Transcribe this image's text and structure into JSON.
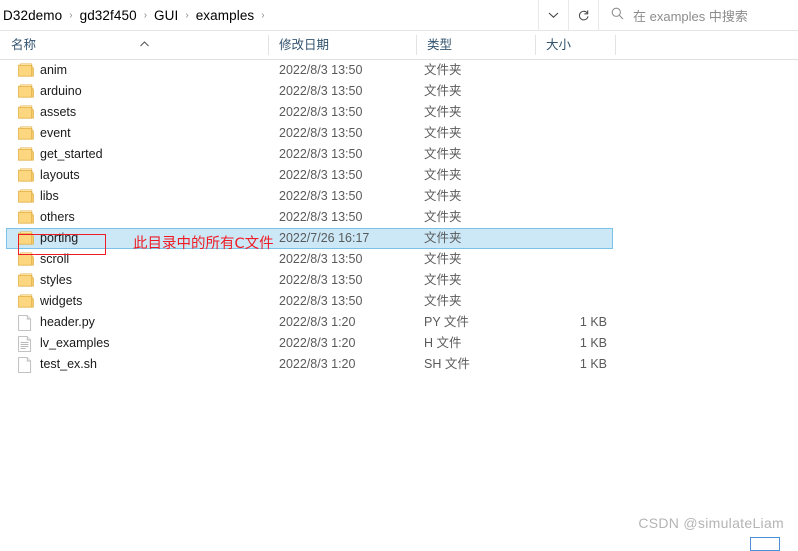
{
  "address_bar": {
    "breadcrumb": [
      {
        "label": "D32demo"
      },
      {
        "label": "gd32f450"
      },
      {
        "label": "GUI"
      },
      {
        "label": "examples"
      }
    ],
    "separator": "›",
    "dropdown_icon": "chevron-down-icon",
    "refresh_icon": "refresh-icon",
    "search": {
      "icon": "search-icon",
      "placeholder": "在 examples 中搜索",
      "value": ""
    }
  },
  "columns": {
    "name": "名称",
    "date_modified": "修改日期",
    "type": "类型",
    "size": "大小",
    "sort_column": "名称",
    "sort_direction": "ascending"
  },
  "files": [
    {
      "name": "anim",
      "date": "2022/8/3 13:50",
      "type": "文件夹",
      "size": "",
      "icon": "folder-icon",
      "selected": false
    },
    {
      "name": "arduino",
      "date": "2022/8/3 13:50",
      "type": "文件夹",
      "size": "",
      "icon": "folder-icon",
      "selected": false
    },
    {
      "name": "assets",
      "date": "2022/8/3 13:50",
      "type": "文件夹",
      "size": "",
      "icon": "folder-icon",
      "selected": false
    },
    {
      "name": "event",
      "date": "2022/8/3 13:50",
      "type": "文件夹",
      "size": "",
      "icon": "folder-icon",
      "selected": false
    },
    {
      "name": "get_started",
      "date": "2022/8/3 13:50",
      "type": "文件夹",
      "size": "",
      "icon": "folder-icon",
      "selected": false
    },
    {
      "name": "layouts",
      "date": "2022/8/3 13:50",
      "type": "文件夹",
      "size": "",
      "icon": "folder-icon",
      "selected": false
    },
    {
      "name": "libs",
      "date": "2022/8/3 13:50",
      "type": "文件夹",
      "size": "",
      "icon": "folder-icon",
      "selected": false
    },
    {
      "name": "others",
      "date": "2022/8/3 13:50",
      "type": "文件夹",
      "size": "",
      "icon": "folder-icon",
      "selected": false
    },
    {
      "name": "porting",
      "date": "2022/7/26 16:17",
      "type": "文件夹",
      "size": "",
      "icon": "folder-icon",
      "selected": true
    },
    {
      "name": "scroll",
      "date": "2022/8/3 13:50",
      "type": "文件夹",
      "size": "",
      "icon": "folder-icon",
      "selected": false
    },
    {
      "name": "styles",
      "date": "2022/8/3 13:50",
      "type": "文件夹",
      "size": "",
      "icon": "folder-icon",
      "selected": false
    },
    {
      "name": "widgets",
      "date": "2022/8/3 13:50",
      "type": "文件夹",
      "size": "",
      "icon": "folder-icon",
      "selected": false
    },
    {
      "name": "header.py",
      "date": "2022/8/3 1:20",
      "type": "PY 文件",
      "size": "1 KB",
      "icon": "blank-file-icon",
      "selected": false
    },
    {
      "name": "lv_examples",
      "date": "2022/8/3 1:20",
      "type": "H 文件",
      "size": "1 KB",
      "icon": "text-file-icon",
      "selected": false
    },
    {
      "name": "test_ex.sh",
      "date": "2022/8/3 1:20",
      "type": "SH 文件",
      "size": "1 KB",
      "icon": "blank-file-icon",
      "selected": false
    }
  ],
  "annotation": {
    "text": "此目录中的所有C文件",
    "color": "#ee1c25",
    "highlighted_item": "porting"
  },
  "watermark": {
    "text": "CSDN @simulateLiam",
    "color": "#b4b4b4"
  },
  "colors": {
    "selection_fill": "#cce8f7",
    "selection_border": "#7cc2e8",
    "header_text": "#33536f",
    "folder_icon": "#ffd67a",
    "annotation_red": "#ee1c25",
    "corner_box_border": "#4a90d9"
  }
}
